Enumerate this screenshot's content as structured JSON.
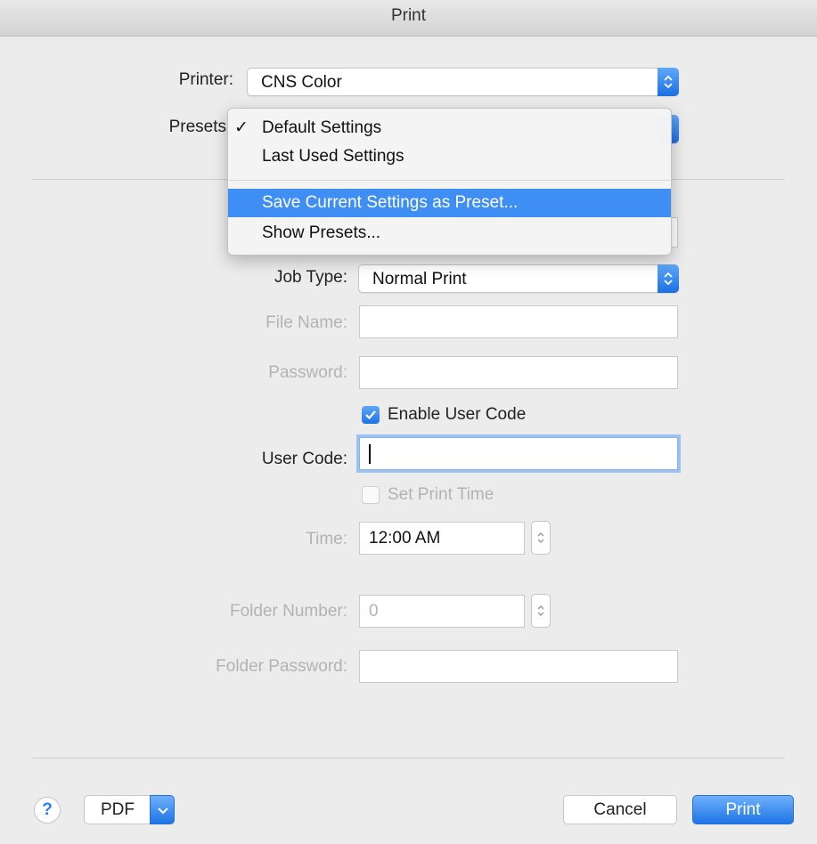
{
  "window": {
    "title": "Print"
  },
  "printer": {
    "label": "Printer:",
    "value": "CNS Color"
  },
  "presets": {
    "label": "Presets",
    "menu": {
      "items": [
        {
          "label": "Default Settings",
          "checked": true
        },
        {
          "label": "Last Used Settings"
        },
        {
          "label": "Save Current Settings as Preset...",
          "highlighted": true
        },
        {
          "label": "Show Presets..."
        }
      ],
      "check_glyph": "✓"
    }
  },
  "job_type": {
    "label": "Job Type:",
    "value": "Normal Print"
  },
  "file_name": {
    "label": "File Name:",
    "value": ""
  },
  "password": {
    "label": "Password:",
    "value": ""
  },
  "enable_user_code": {
    "label": "Enable User Code",
    "checked": true
  },
  "user_code": {
    "label": "User Code:",
    "value": ""
  },
  "set_print_time": {
    "label": "Set Print Time",
    "checked": false
  },
  "time": {
    "label": "Time:",
    "value": "12:00 AM"
  },
  "folder_number": {
    "label": "Folder Number:",
    "value": "0"
  },
  "folder_password": {
    "label": "Folder Password:",
    "value": ""
  },
  "footer": {
    "help_label": "?",
    "pdf_label": "PDF",
    "cancel_label": "Cancel",
    "print_label": "Print"
  },
  "colors": {
    "accent": "#3f8ef3",
    "disabled_text": "#b3b3b3"
  }
}
